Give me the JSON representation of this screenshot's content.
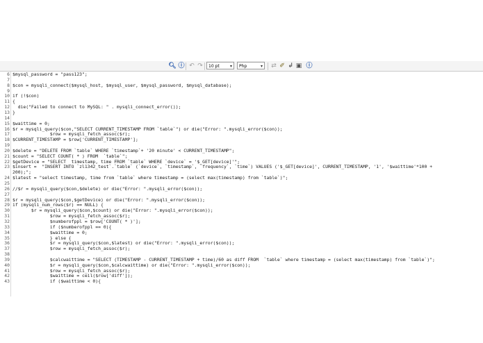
{
  "toolbar": {
    "font_size": "10 pt",
    "language": "Php"
  },
  "editor": {
    "lines": [
      {
        "n": "6",
        "text": "$mysql_password = \"pass123\";"
      },
      {
        "n": "7",
        "text": ""
      },
      {
        "n": "8",
        "text": "$con = mysqli_connect($mysql_host, $mysql_user, $mysql_password, $mysql_database);"
      },
      {
        "n": "9",
        "text": ""
      },
      {
        "n": "10",
        "text": "if (!$con)"
      },
      {
        "n": "11",
        "text": "{"
      },
      {
        "n": "12",
        "text": "  die(\"Failed to connect to MySQL: \" . mysqli_connect_error());"
      },
      {
        "n": "13",
        "text": "}"
      },
      {
        "n": "14",
        "text": ""
      },
      {
        "n": "15",
        "text": "$waittime = 0;"
      },
      {
        "n": "16",
        "text": "$r = mysqli_query($con,\"SELECT CURRENT_TIMESTAMP FROM `table`\") or die(\"Error: \".mysqli_error($con));"
      },
      {
        "n": "17",
        "text": "              $row = mysqli_fetch_assoc($r);"
      },
      {
        "n": "18",
        "text": "$CURRENT_TIMESTAMP = $row['CURRENT_TIMESTAMP'];"
      },
      {
        "n": "19",
        "text": ""
      },
      {
        "n": "20",
        "text": "$delete = \"DELETE FROM `table` WHERE `timestamp`+ '20 minute' < CURRENT_TIMESTAMP\";"
      },
      {
        "n": "21",
        "text": "$count = \"SELECT COUNT( * ) FROM  `table`\";"
      },
      {
        "n": "22",
        "text": "$getDevice = \"SELECT  timestamp, time FROM `table` WHERE `device` = '$_GET[device]'\";"
      },
      {
        "n": "23",
        "text": "$insert =  \"INSERT INTO `zl1342_test`.`table` (`device`, `timestamp`, `frequency`, `time`) VALUES ('$_GET[device]', CURRENT_TIMESTAMP, '1', '$waittime'*100 +"
      },
      {
        "n": "",
        "text": "200);\";"
      },
      {
        "n": "24",
        "text": "$latest = \"select timestamp, time from `table` where timestamp = (select max(timestamp) from `table`)\";"
      },
      {
        "n": "25",
        "text": ""
      },
      {
        "n": "26",
        "text": "//$r = mysqli_query($con,$delete) or die(\"Error: \".mysqli_error($con));"
      },
      {
        "n": "27",
        "text": ""
      },
      {
        "n": "28",
        "text": "$r = mysqli_query($con,$getDevice) or die(\"Error: \".mysqli_error($con));"
      },
      {
        "n": "29",
        "text": "if (mysqli_num_rows($r) == NULL) {"
      },
      {
        "n": "30",
        "text": "       $r = mysqli_query($con,$count) or die(\"Error: \".mysqli_error($con));"
      },
      {
        "n": "31",
        "text": "              $row = mysqli_fetch_assoc($r);"
      },
      {
        "n": "32",
        "text": "              $numberofppl = $row['COUNT( * )'];"
      },
      {
        "n": "33",
        "text": "              if ($numberofppl == 0){"
      },
      {
        "n": "34",
        "text": "              $waittime = 0;"
      },
      {
        "n": "35",
        "text": "              } else {"
      },
      {
        "n": "36",
        "text": "              $r = mysqli_query($con,$latest) or die(\"Error: \".mysqli_error($con));"
      },
      {
        "n": "37",
        "text": "              $row = mysqli_fetch_assoc($r);"
      },
      {
        "n": "38",
        "text": ""
      },
      {
        "n": "39",
        "text": "              $calcwaittime = \"SELECT (TIMESTAMP - CURRENT_TIMESTAMP + time)/60 as diff FROM  `table` where timestamp = (select max(timestamp) from `table`)\";"
      },
      {
        "n": "40",
        "text": "              $r = mysqli_query($con,$calcwaittime) or die(\"Error: \".mysqli_error($con));"
      },
      {
        "n": "41",
        "text": "              $row = mysqli_fetch_assoc($r);"
      },
      {
        "n": "42",
        "text": "              $waittime = ceil($row['diff']);"
      },
      {
        "n": "43",
        "text": "              if ($waittime < 0){"
      }
    ]
  },
  "icons": [
    "binoculars-icon",
    "help-circle-icon",
    "undo-icon",
    "redo-icon",
    "font-size-select",
    "language-select",
    "search-replace-icon",
    "wand-icon",
    "reindent-icon",
    "fullscreen-icon",
    "info-icon"
  ]
}
